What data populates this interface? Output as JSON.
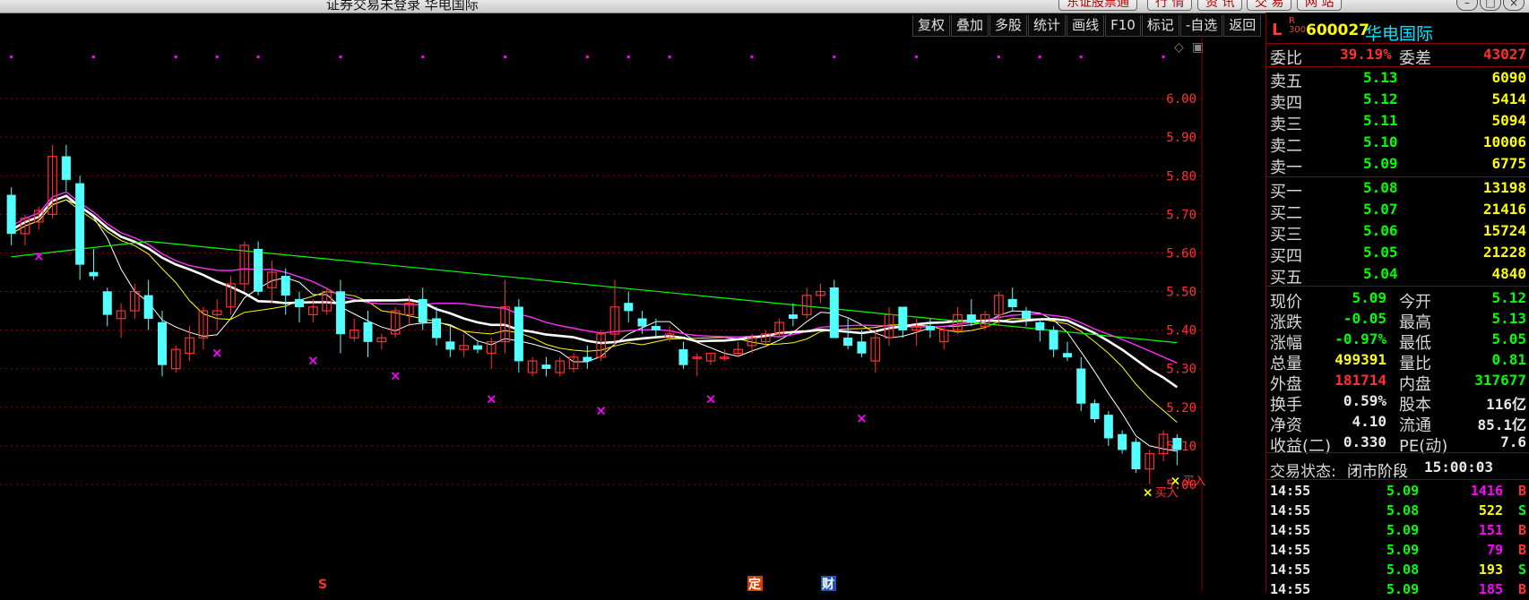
{
  "window": {
    "title": "证券交易未登录  华电国际",
    "tabs": [
      "东证股票通",
      "行 情",
      "资 讯",
      "交 易",
      "网 站"
    ],
    "controls": [
      "–",
      "□",
      "×"
    ]
  },
  "toolbar": {
    "buttons": [
      "复权",
      "叠加",
      "多股",
      "统计",
      "画线",
      "F10",
      "标记",
      "-自选",
      "返回"
    ],
    "corner_icons": [
      "◇",
      "▣"
    ]
  },
  "stock": {
    "market_flag": "L",
    "index_tag_top": "R",
    "index_tag_bottom": "300",
    "code": "600027",
    "name": "华电国际"
  },
  "order_book": {
    "ratio_label": "委比",
    "ratio_value": "39.19%",
    "diff_label": "委差",
    "diff_value": "43027",
    "asks": [
      {
        "label": "卖五",
        "price": "5.13",
        "volume": "6090"
      },
      {
        "label": "卖四",
        "price": "5.12",
        "volume": "5414"
      },
      {
        "label": "卖三",
        "price": "5.11",
        "volume": "5094"
      },
      {
        "label": "卖二",
        "price": "5.10",
        "volume": "10006"
      },
      {
        "label": "卖一",
        "price": "5.09",
        "volume": "6775"
      }
    ],
    "bids": [
      {
        "label": "买一",
        "price": "5.08",
        "volume": "13198"
      },
      {
        "label": "买二",
        "price": "5.07",
        "volume": "21416"
      },
      {
        "label": "买三",
        "price": "5.06",
        "volume": "15724"
      },
      {
        "label": "买四",
        "price": "5.05",
        "volume": "21228"
      },
      {
        "label": "买五",
        "price": "5.04",
        "volume": "4840"
      }
    ]
  },
  "quote": {
    "rows": [
      {
        "l1": "现价",
        "v1": "5.09",
        "c1": "green",
        "l2": "今开",
        "v2": "5.12",
        "c2": "green"
      },
      {
        "l1": "涨跌",
        "v1": "-0.05",
        "c1": "green",
        "l2": "最高",
        "v2": "5.13",
        "c2": "green"
      },
      {
        "l1": "涨幅",
        "v1": "-0.97%",
        "c1": "green",
        "l2": "最低",
        "v2": "5.05",
        "c2": "green"
      },
      {
        "l1": "总量",
        "v1": "499391",
        "c1": "yellow",
        "l2": "量比",
        "v2": "0.81",
        "c2": "green"
      },
      {
        "l1": "外盘",
        "v1": "181714",
        "c1": "red",
        "l2": "内盘",
        "v2": "317677",
        "c2": "green"
      },
      {
        "l1": "换手",
        "v1": "0.59%",
        "c1": "white",
        "l2": "股本",
        "v2": "116亿",
        "c2": "white"
      },
      {
        "l1": "净资",
        "v1": "4.10",
        "c1": "white",
        "l2": "流通",
        "v2": "85.1亿",
        "c2": "white"
      },
      {
        "l1": "收益(二)",
        "v1": "0.330",
        "c1": "white",
        "l2": "PE(动)",
        "v2": "7.6",
        "c2": "white"
      }
    ],
    "status_label": "交易状态:",
    "status_value": "闭市阶段",
    "status_time": "15:00:03"
  },
  "ticks": [
    {
      "time": "14:55",
      "price": "5.09",
      "vol": "1416",
      "side": "B"
    },
    {
      "time": "14:55",
      "price": "5.08",
      "vol": "522",
      "side": "S"
    },
    {
      "time": "14:55",
      "price": "5.09",
      "vol": "151",
      "side": "B"
    },
    {
      "time": "14:55",
      "price": "5.09",
      "vol": "79",
      "side": "B"
    },
    {
      "time": "14:55",
      "price": "5.08",
      "vol": "193",
      "side": "S"
    },
    {
      "time": "14:55",
      "price": "5.09",
      "vol": "185",
      "side": "B"
    }
  ],
  "colors": {
    "up": "#ff3030",
    "down": "#54ffff",
    "ma5": "#ffffff",
    "ma10": "#ffff00",
    "ma20": "#ff30ff",
    "ma60": "#00ff00",
    "grid": "#8b0000",
    "signal": "#ff00ff"
  },
  "chart_data": {
    "type": "candlestick",
    "y_ticks": [
      "6.00",
      "5.90",
      "5.80",
      "5.70",
      "5.60",
      "5.50",
      "5.40",
      "5.30",
      "5.20",
      "5.10",
      "5.00"
    ],
    "ylim": [
      4.87,
      6.1
    ],
    "buy_label": "买入",
    "markers": {
      "s": "S",
      "ding": "定",
      "cai": "财"
    },
    "candles": [
      [
        5.75,
        5.77,
        5.62,
        5.65
      ],
      [
        5.65,
        5.7,
        5.62,
        5.69
      ],
      [
        5.68,
        5.72,
        5.66,
        5.71
      ],
      [
        5.7,
        5.88,
        5.69,
        5.85
      ],
      [
        5.85,
        5.88,
        5.76,
        5.79
      ],
      [
        5.78,
        5.8,
        5.53,
        5.57
      ],
      [
        5.55,
        5.61,
        5.53,
        5.54
      ],
      [
        5.5,
        5.51,
        5.41,
        5.44
      ],
      [
        5.43,
        5.47,
        5.38,
        5.45
      ],
      [
        5.45,
        5.52,
        5.43,
        5.5
      ],
      [
        5.49,
        5.53,
        5.4,
        5.43
      ],
      [
        5.42,
        5.45,
        5.28,
        5.31
      ],
      [
        5.3,
        5.36,
        5.29,
        5.35
      ],
      [
        5.34,
        5.41,
        5.32,
        5.38
      ],
      [
        5.38,
        5.46,
        5.35,
        5.45
      ],
      [
        5.44,
        5.48,
        5.4,
        5.45
      ],
      [
        5.46,
        5.54,
        5.44,
        5.52
      ],
      [
        5.52,
        5.63,
        5.5,
        5.62
      ],
      [
        5.61,
        5.63,
        5.49,
        5.5
      ],
      [
        5.51,
        5.58,
        5.47,
        5.55
      ],
      [
        5.54,
        5.56,
        5.44,
        5.49
      ],
      [
        5.48,
        5.5,
        5.42,
        5.46
      ],
      [
        5.44,
        5.48,
        5.42,
        5.46
      ],
      [
        5.45,
        5.51,
        5.44,
        5.5
      ],
      [
        5.5,
        5.53,
        5.34,
        5.39
      ],
      [
        5.38,
        5.43,
        5.37,
        5.4
      ],
      [
        5.42,
        5.45,
        5.33,
        5.37
      ],
      [
        5.37,
        5.39,
        5.35,
        5.38
      ],
      [
        5.39,
        5.46,
        5.38,
        5.45
      ],
      [
        5.44,
        5.49,
        5.41,
        5.47
      ],
      [
        5.48,
        5.51,
        5.4,
        5.42
      ],
      [
        5.43,
        5.46,
        5.36,
        5.38
      ],
      [
        5.37,
        5.41,
        5.33,
        5.35
      ],
      [
        5.35,
        5.39,
        5.33,
        5.36
      ],
      [
        5.36,
        5.37,
        5.34,
        5.35
      ],
      [
        5.34,
        5.38,
        5.3,
        5.37
      ],
      [
        5.37,
        5.53,
        5.34,
        5.46
      ],
      [
        5.46,
        5.48,
        5.29,
        5.32
      ],
      [
        5.29,
        5.33,
        5.28,
        5.32
      ],
      [
        5.31,
        5.33,
        5.28,
        5.3
      ],
      [
        5.29,
        5.33,
        5.28,
        5.32
      ],
      [
        5.3,
        5.34,
        5.29,
        5.33
      ],
      [
        5.33,
        5.36,
        5.3,
        5.32
      ],
      [
        5.33,
        5.4,
        5.32,
        5.39
      ],
      [
        5.39,
        5.53,
        5.36,
        5.46
      ],
      [
        5.47,
        5.5,
        5.42,
        5.45
      ],
      [
        5.43,
        5.45,
        5.39,
        5.41
      ],
      [
        5.41,
        5.43,
        5.38,
        5.4
      ],
      [
        5.38,
        5.41,
        5.37,
        5.39
      ],
      [
        5.35,
        5.37,
        5.3,
        5.31
      ],
      [
        5.33,
        5.34,
        5.28,
        5.33
      ],
      [
        5.32,
        5.34,
        5.31,
        5.34
      ],
      [
        5.33,
        5.35,
        5.32,
        5.33
      ],
      [
        5.34,
        5.37,
        5.33,
        5.35
      ],
      [
        5.36,
        5.39,
        5.34,
        5.38
      ],
      [
        5.37,
        5.4,
        5.36,
        5.39
      ],
      [
        5.39,
        5.43,
        5.38,
        5.42
      ],
      [
        5.44,
        5.47,
        5.41,
        5.43
      ],
      [
        5.44,
        5.51,
        5.43,
        5.49
      ],
      [
        5.49,
        5.52,
        5.47,
        5.5
      ],
      [
        5.51,
        5.53,
        5.44,
        5.38
      ],
      [
        5.38,
        5.43,
        5.35,
        5.36
      ],
      [
        5.37,
        5.4,
        5.33,
        5.34
      ],
      [
        5.32,
        5.4,
        5.29,
        5.38
      ],
      [
        5.38,
        5.46,
        5.36,
        5.44
      ],
      [
        5.46,
        5.46,
        5.38,
        5.4
      ],
      [
        5.4,
        5.43,
        5.36,
        5.41
      ],
      [
        5.41,
        5.43,
        5.38,
        5.4
      ],
      [
        5.37,
        5.41,
        5.35,
        5.4
      ],
      [
        5.4,
        5.46,
        5.39,
        5.44
      ],
      [
        5.44,
        5.48,
        5.41,
        5.42
      ],
      [
        5.41,
        5.45,
        5.4,
        5.44
      ],
      [
        5.44,
        5.5,
        5.41,
        5.49
      ],
      [
        5.48,
        5.51,
        5.45,
        5.46
      ],
      [
        5.45,
        5.46,
        5.41,
        5.43
      ],
      [
        5.42,
        5.43,
        5.37,
        5.4
      ],
      [
        5.4,
        5.41,
        5.33,
        5.35
      ],
      [
        5.34,
        5.37,
        5.32,
        5.33
      ],
      [
        5.3,
        5.33,
        5.19,
        5.21
      ],
      [
        5.21,
        5.22,
        5.16,
        5.17
      ],
      [
        5.18,
        5.19,
        5.1,
        5.12
      ],
      [
        5.13,
        5.14,
        5.08,
        5.09
      ],
      [
        5.11,
        5.12,
        5.03,
        5.04
      ],
      [
        5.04,
        5.09,
        5.0,
        5.08
      ],
      [
        5.08,
        5.14,
        5.06,
        5.13
      ],
      [
        5.12,
        5.13,
        5.05,
        5.09
      ]
    ]
  }
}
